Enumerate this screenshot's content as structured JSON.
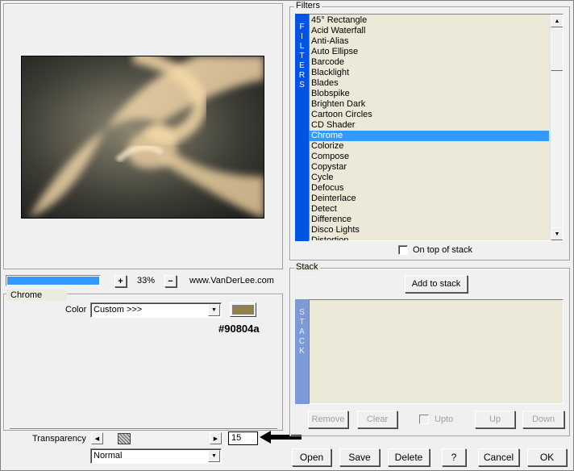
{
  "zoom": {
    "plus": "+",
    "value": "33%",
    "minus": "−",
    "site": "www.VanDerLee.com",
    "progress_percent": 100
  },
  "filters": {
    "title": "Filters",
    "side_label": [
      "F",
      "I",
      "L",
      "T",
      "E",
      "R",
      "S"
    ],
    "items": [
      "45° Rectangle",
      "Acid Waterfall",
      "Anti-Alias",
      "Auto Ellipse",
      "Barcode",
      "Blacklight",
      "Blades",
      "Blobspike",
      "Brighten Dark",
      "Cartoon Circles",
      "CD Shader",
      "Chrome",
      "Colorize",
      "Compose",
      "Copystar",
      "Cycle",
      "Defocus",
      "Deinterlace",
      "Detect",
      "Difference",
      "Disco Lights",
      "Distortion"
    ],
    "selected": "Chrome",
    "ontop_label": "On top of stack"
  },
  "stack": {
    "title": "Stack",
    "add_label": "Add to stack",
    "side_label": [
      "S",
      "T",
      "A",
      "C",
      "K"
    ],
    "remove": "Remove",
    "clear": "Clear",
    "upto": "Upto",
    "up": "Up",
    "down": "Down"
  },
  "chrome": {
    "title": "Chrome",
    "color_label": "Color",
    "color_value": "Custom >>>",
    "swatch_color": "#90804a",
    "hex_label": "#90804a",
    "transparency_label": "Transparency",
    "transparency_value": "15",
    "blend_value": "Normal"
  },
  "buttons": {
    "open": "Open",
    "save": "Save",
    "delete": "Delete",
    "help": "?",
    "cancel": "Cancel",
    "ok": "OK"
  }
}
